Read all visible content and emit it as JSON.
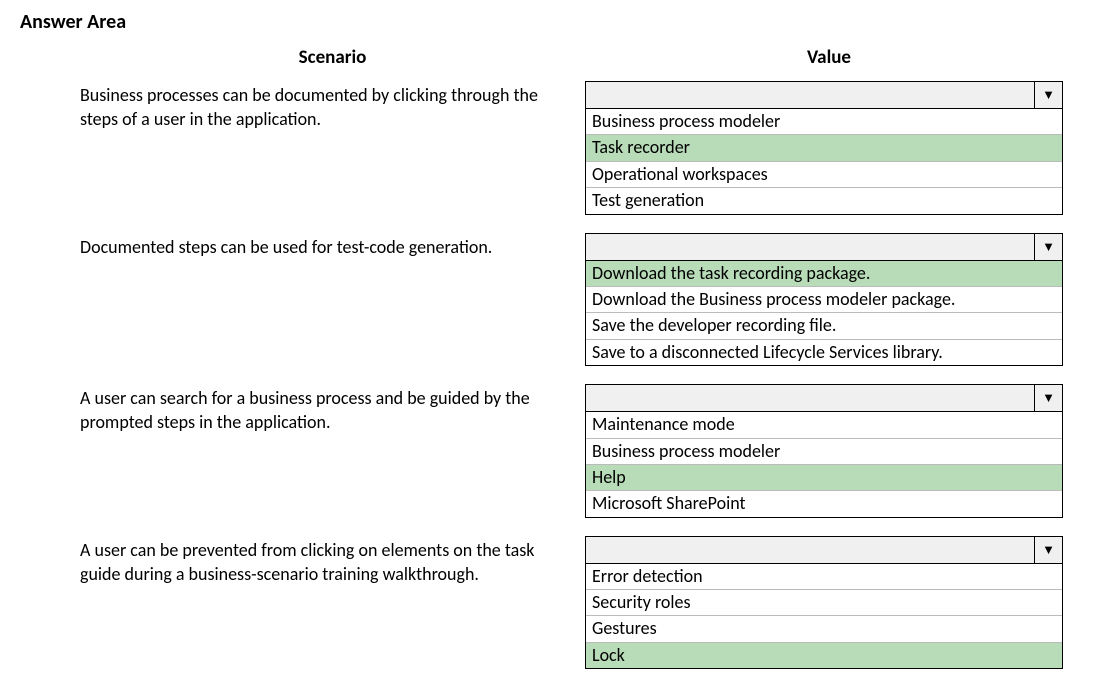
{
  "title": "Answer Area",
  "headers": {
    "scenario": "Scenario",
    "value": "Value"
  },
  "rows": [
    {
      "scenario": "Business processes can be documented by clicking through the steps of a user in the application.",
      "options": [
        {
          "label": "Business process modeler",
          "highlighted": false
        },
        {
          "label": "Task recorder",
          "highlighted": true
        },
        {
          "label": "Operational workspaces",
          "highlighted": false
        },
        {
          "label": "Test generation",
          "highlighted": false
        }
      ]
    },
    {
      "scenario": "Documented steps can be used for test-code generation.",
      "options": [
        {
          "label": "Download the task recording package.",
          "highlighted": true
        },
        {
          "label": "Download the Business process modeler package.",
          "highlighted": false
        },
        {
          "label": "Save the developer recording file.",
          "highlighted": false
        },
        {
          "label": "Save to a disconnected Lifecycle Services library.",
          "highlighted": false
        }
      ]
    },
    {
      "scenario": "A user can search for a business process and be guided by the prompted steps in the application.",
      "options": [
        {
          "label": "Maintenance mode",
          "highlighted": false
        },
        {
          "label": "Business process modeler",
          "highlighted": false
        },
        {
          "label": "Help",
          "highlighted": true
        },
        {
          "label": "Microsoft SharePoint",
          "highlighted": false
        }
      ]
    },
    {
      "scenario": "A user can be prevented from clicking on elements on the task guide during a business-scenario training walkthrough.",
      "options": [
        {
          "label": "Error detection",
          "highlighted": false
        },
        {
          "label": "Security roles",
          "highlighted": false
        },
        {
          "label": "Gestures",
          "highlighted": false
        },
        {
          "label": "Lock",
          "highlighted": true
        }
      ]
    }
  ]
}
